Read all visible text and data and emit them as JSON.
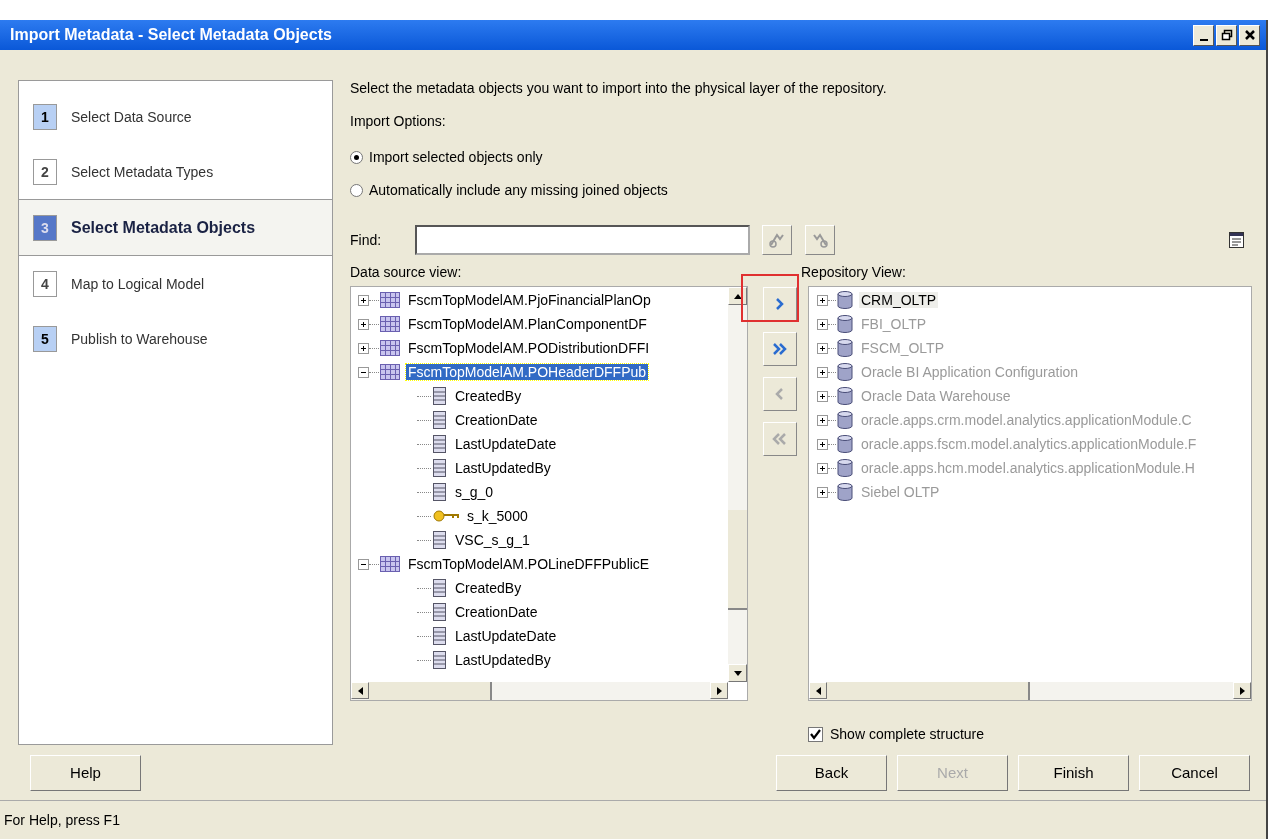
{
  "window": {
    "title": "Import Metadata - Select Metadata Objects"
  },
  "steps": [
    {
      "number": "1",
      "label": "Select Data Source",
      "selected": false,
      "enabled": true
    },
    {
      "number": "2",
      "label": "Select Metadata Types",
      "selected": false,
      "enabled": false
    },
    {
      "number": "3",
      "label": "Select Metadata Objects",
      "selected": true,
      "enabled": true
    },
    {
      "number": "4",
      "label": "Map to Logical Model",
      "selected": false,
      "enabled": false
    },
    {
      "number": "5",
      "label": "Publish to Warehouse",
      "selected": false,
      "enabled": true
    }
  ],
  "instruction": "Select the metadata objects you want to import into the physical layer of the repository.",
  "import_options": {
    "label": "Import Options:",
    "options": [
      {
        "label": "Import selected objects only",
        "selected": true
      },
      {
        "label": "Automatically include any missing joined objects",
        "selected": false
      }
    ]
  },
  "find": {
    "label": "Find:"
  },
  "data_source_view": {
    "label": "Data source view:",
    "items": [
      {
        "kind": "table",
        "label": "FscmTopModelAM.PjoFinancialPlanOp",
        "expanded": false,
        "selected": false
      },
      {
        "kind": "table",
        "label": "FscmTopModelAM.PlanComponentDF",
        "expanded": false,
        "selected": false
      },
      {
        "kind": "table",
        "label": "FscmTopModelAM.PODistributionDFFI",
        "expanded": false,
        "selected": false
      },
      {
        "kind": "table",
        "label": "FscmTopModelAM.POHeaderDFFPub",
        "expanded": true,
        "selected": true,
        "children": [
          {
            "kind": "column",
            "label": "CreatedBy",
            "selected": false
          },
          {
            "kind": "column",
            "label": "CreationDate",
            "selected": false
          },
          {
            "kind": "column",
            "label": "LastUpdateDate",
            "selected": false
          },
          {
            "kind": "column",
            "label": "LastUpdatedBy",
            "selected": false
          },
          {
            "kind": "column",
            "label": "s_g_0",
            "selected": false
          },
          {
            "kind": "key",
            "label": "s_k_5000",
            "selected": false
          },
          {
            "kind": "column",
            "label": "VSC_s_g_1",
            "selected": false
          }
        ]
      },
      {
        "kind": "table",
        "label": "FscmTopModelAM.POLineDFFPublicE",
        "expanded": true,
        "selected": false,
        "children": [
          {
            "kind": "column",
            "label": "CreatedBy",
            "selected": false
          },
          {
            "kind": "column",
            "label": "CreationDate",
            "selected": false
          },
          {
            "kind": "column",
            "label": "LastUpdateDate",
            "selected": false
          },
          {
            "kind": "column",
            "label": "LastUpdatedBy",
            "selected": false
          }
        ]
      }
    ]
  },
  "transfer_buttons": [
    {
      "kind": "add",
      "disabled": false,
      "highlighted": true
    },
    {
      "kind": "add_all",
      "disabled": false,
      "highlighted": false
    },
    {
      "kind": "remove",
      "disabled": true,
      "highlighted": false
    },
    {
      "kind": "remove_all",
      "disabled": true,
      "highlighted": false
    }
  ],
  "repository_view": {
    "label": "Repository View:",
    "items": [
      {
        "label": "CRM_OLTP",
        "expanded": false,
        "disabled": false,
        "selected": true
      },
      {
        "label": "FBI_OLTP",
        "expanded": false,
        "disabled": true,
        "selected": false
      },
      {
        "label": "FSCM_OLTP",
        "expanded": false,
        "disabled": true,
        "selected": false
      },
      {
        "label": "Oracle BI Application Configuration",
        "expanded": false,
        "disabled": true,
        "selected": false
      },
      {
        "label": "Oracle Data Warehouse",
        "expanded": false,
        "disabled": true,
        "selected": false
      },
      {
        "label": "oracle.apps.crm.model.analytics.applicationModule.C",
        "expanded": false,
        "disabled": true,
        "selected": false
      },
      {
        "label": "oracle.apps.fscm.model.analytics.applicationModule.F",
        "expanded": false,
        "disabled": true,
        "selected": false
      },
      {
        "label": "oracle.apps.hcm.model.analytics.applicationModule.H",
        "expanded": false,
        "disabled": true,
        "selected": false
      },
      {
        "label": "Siebel OLTP",
        "expanded": false,
        "disabled": true,
        "selected": false
      }
    ]
  },
  "show_complete_structure": {
    "label": "Show complete structure",
    "checked": true
  },
  "buttons": [
    {
      "kind": "help",
      "label": "Help"
    },
    {
      "kind": "nav",
      "label": "Back",
      "disabled": false
    },
    {
      "kind": "nav",
      "label": "Next",
      "disabled": true
    },
    {
      "kind": "nav",
      "label": "Finish",
      "disabled": false
    },
    {
      "kind": "nav",
      "label": "Cancel",
      "disabled": false
    }
  ],
  "status_bar": "For Help, press F1"
}
